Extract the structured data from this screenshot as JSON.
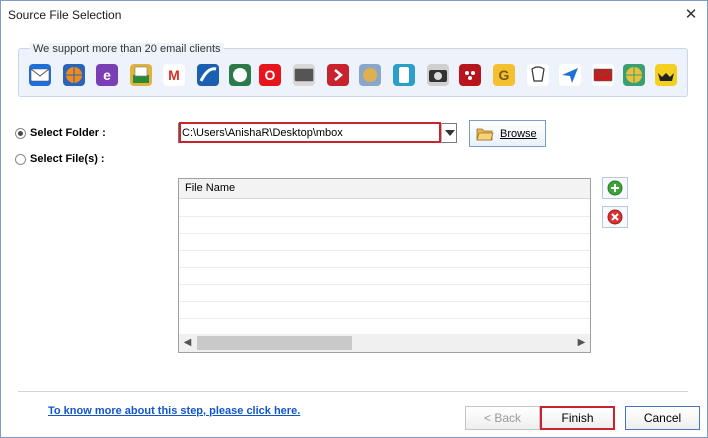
{
  "window": {
    "title": "Source File Selection",
    "close_icon": "close-icon"
  },
  "clients": {
    "caption": "We support more than 20 email clients",
    "icons": [
      "windows-mail-icon",
      "thunderbird-icon",
      "entourage-icon",
      "mail-folder-icon",
      "gmail-icon",
      "postbox-icon",
      "seamonkey-icon",
      "opera-mail-icon",
      "spicebird-icon",
      "claws-mail-icon",
      "evolution-icon",
      "netscape-icon",
      "eudora-icon",
      "sylpheed-icon",
      "gnu-mail-icon",
      "mutt-icon",
      "powermail-icon",
      "pocomail-icon",
      "mail-envelope-icon",
      "mulberry-icon",
      "the-bat-icon"
    ]
  },
  "source": {
    "select_folder_label": "Select Folder :",
    "select_files_label": "Select File(s) :",
    "selected_option": "folder",
    "path_value": "C:\\Users\\AnishaR\\Desktop\\mbox",
    "browse_label": "Browse"
  },
  "grid": {
    "header": "File Name",
    "rows": []
  },
  "footer": {
    "help_link": "To know more about this step, please click here.",
    "back_label": "< Back",
    "finish_label": "Finish",
    "cancel_label": "Cancel"
  },
  "colors": {
    "highlight": "#c9242b",
    "link": "#1155cc",
    "panel_bg": "#eef3fb"
  }
}
